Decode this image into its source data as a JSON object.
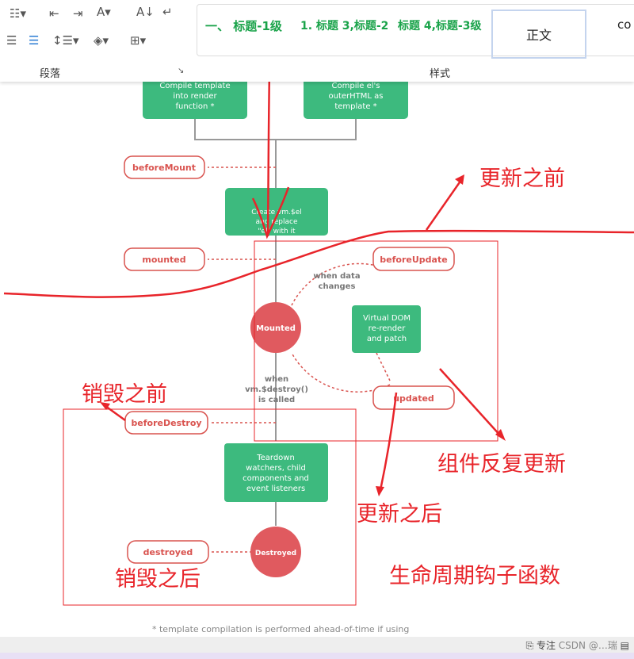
{
  "ribbon": {
    "paragraph_label": "段落",
    "styles_label": "样式",
    "styles": [
      "一、 标题-1级",
      "1. 标题 3,标题-2",
      "标题 4,标题-3级"
    ],
    "normal_style": "正文",
    "more_style": "co"
  },
  "diagram": {
    "compile_template": "Compile template into render function *",
    "compile_el": "Compile el's outerHTML as template *",
    "before_mount": "beforeMount",
    "create_vm": "Create vm.$el and replace \"el\" with it",
    "mounted_hook": "mounted",
    "mounted_state": "Mounted",
    "when_data_changes": [
      "when data",
      "changes"
    ],
    "before_update": "beforeUpdate",
    "virtual_dom": [
      "Virtual DOM",
      "re-render",
      "and patch"
    ],
    "updated": "updated",
    "when_destroy": [
      "when",
      "vm.$destroy()",
      "is called"
    ],
    "before_destroy": "beforeDestroy",
    "teardown": [
      "Teardown",
      "watchers, child",
      "components and",
      "event listeners"
    ],
    "destroyed_state": "Destroyed",
    "destroyed_hook": "destroyed",
    "footnote": "* template compilation is performed ahead-of-time if using"
  },
  "annotations": {
    "before_update": "更新之前",
    "before_destroy": "销毁之前",
    "repeat_update": "组件反复更新",
    "after_update": "更新之后",
    "after_destroy": "销毁之后",
    "lifecycle_hooks": "生命周期钩子函数"
  },
  "status": {
    "focus": "专注",
    "watermark": "CSDN @…瑞"
  },
  "colors": {
    "green": "#3dba7e",
    "hook_red": "#d9534f",
    "annotation": "#e8242a"
  }
}
